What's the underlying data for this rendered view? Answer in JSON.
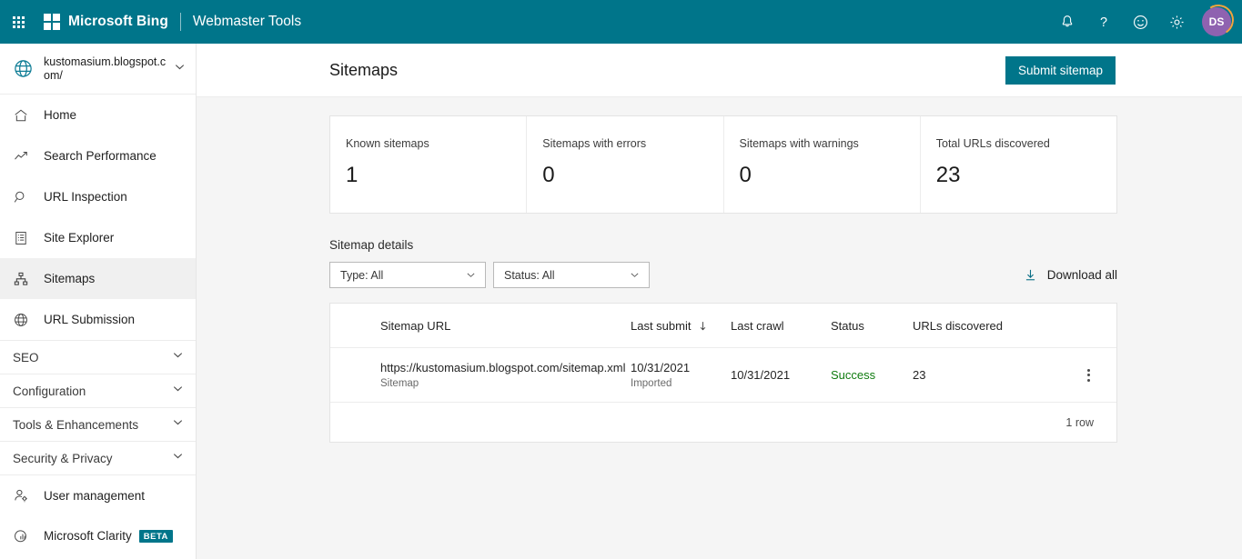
{
  "topbar": {
    "waffle_label": "App launcher",
    "brand": "Microsoft Bing",
    "product": "Webmaster Tools",
    "icons": {
      "notifications": "bell-icon",
      "help": "question-mark-icon",
      "feedback": "smiley-icon",
      "settings": "gear-icon"
    },
    "avatar_initials": "DS"
  },
  "sidebar": {
    "site": {
      "name": "kustomasium.blogspot.com/",
      "icon": "globe-icon",
      "chevron": "chevron-down-icon"
    },
    "items": [
      {
        "label": "Home",
        "icon": "home-icon",
        "selected": false
      },
      {
        "label": "Search Performance",
        "icon": "trending-up-icon",
        "selected": false
      },
      {
        "label": "URL Inspection",
        "icon": "magnifier-icon",
        "selected": false
      },
      {
        "label": "Site Explorer",
        "icon": "list-document-icon",
        "selected": false
      },
      {
        "label": "Sitemaps",
        "icon": "sitemap-icon",
        "selected": true
      },
      {
        "label": "URL Submission",
        "icon": "globe-icon",
        "selected": false
      }
    ],
    "groups": [
      {
        "label": "SEO",
        "chevron": "chevron-down-icon"
      },
      {
        "label": "Configuration",
        "chevron": "chevron-down-icon"
      },
      {
        "label": "Tools & Enhancements",
        "chevron": "chevron-down-icon"
      },
      {
        "label": "Security & Privacy",
        "chevron": "chevron-down-icon"
      }
    ],
    "bottom_items": [
      {
        "label": "User management",
        "icon": "user-gear-icon",
        "badge": ""
      },
      {
        "label": "Microsoft Clarity",
        "icon": "clarity-icon",
        "badge": "BETA"
      }
    ]
  },
  "header": {
    "title": "Sitemaps",
    "submit_label": "Submit sitemap"
  },
  "stats": [
    {
      "label": "Known sitemaps",
      "value": "1"
    },
    {
      "label": "Sitemaps with errors",
      "value": "0"
    },
    {
      "label": "Sitemaps with warnings",
      "value": "0"
    },
    {
      "label": "Total URLs discovered",
      "value": "23"
    }
  ],
  "details": {
    "section_title": "Sitemap details",
    "filter_type": "Type: All",
    "filter_status": "Status: All",
    "download_label": "Download all",
    "download_icon": "download-arrow-icon"
  },
  "table": {
    "columns": {
      "url": "Sitemap URL",
      "last_submit": "Last submit",
      "last_crawl": "Last crawl",
      "status": "Status",
      "urls_discovered": "URLs discovered"
    },
    "sorted_by": "Last submit",
    "sort_direction": "descending",
    "rows": [
      {
        "url": "https://kustomasium.blogspot.com/sitemap.xml",
        "url_sub": "Sitemap",
        "last_submit": "10/31/2021",
        "last_submit_sub": "Imported",
        "last_crawl": "10/31/2021",
        "status": "Success",
        "urls_discovered": "23",
        "menu_icon": "kebab-menu-icon"
      }
    ],
    "footer": "1 row"
  },
  "colors": {
    "accent_teal": "#00758a",
    "success_green": "#107c10",
    "avatar_purple": "#8f62b0",
    "page_bg": "#f5f5f5"
  }
}
